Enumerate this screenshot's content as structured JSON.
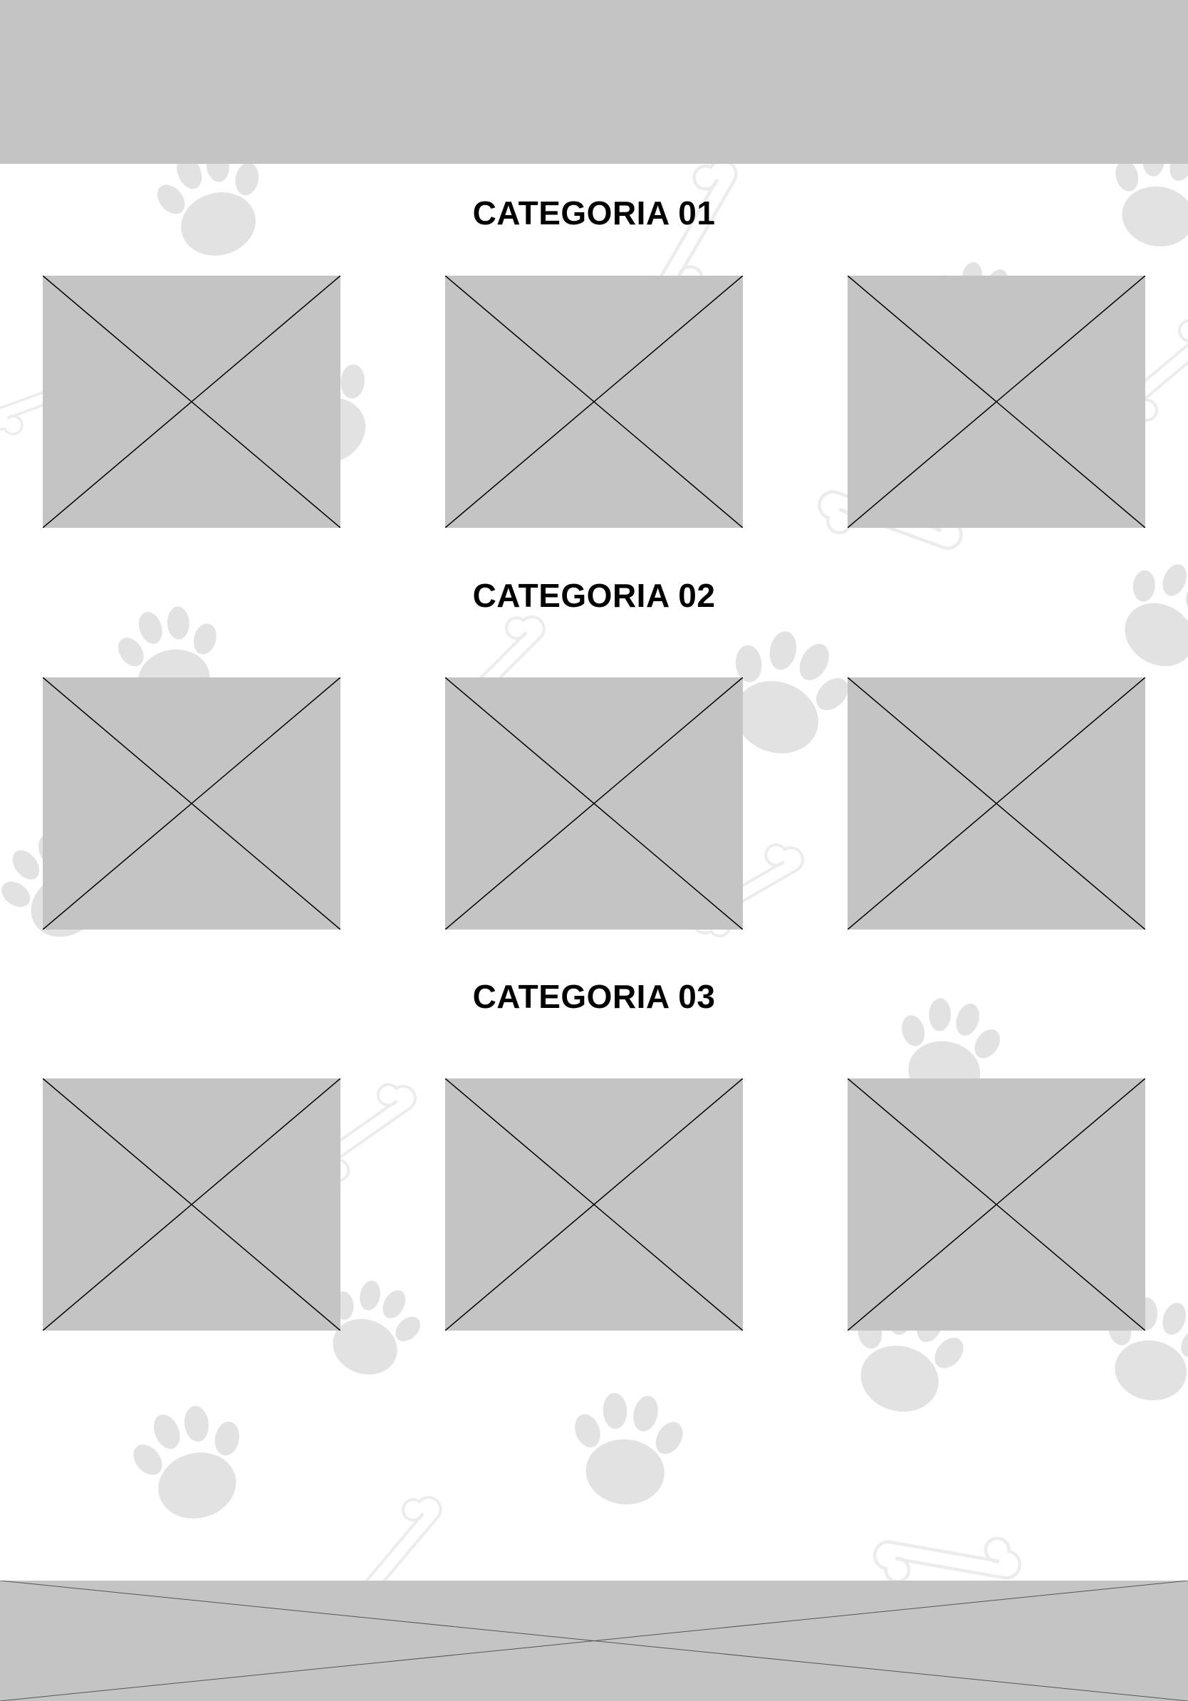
{
  "colors": {
    "placeholder_fill": "#c4c4c4",
    "placeholder_stroke": "#000000",
    "background": "#ffffff",
    "paw_print": "#e2e2e3",
    "bone_outline": "#ececec"
  },
  "header": {
    "icon": "banner-placeholder"
  },
  "categories": [
    {
      "title": "CATEGORIA 01",
      "items": [
        "image-placeholder",
        "image-placeholder",
        "image-placeholder"
      ]
    },
    {
      "title": "CATEGORIA 02",
      "items": [
        "image-placeholder",
        "image-placeholder",
        "image-placeholder"
      ]
    },
    {
      "title": "CATEGORIA 03",
      "items": [
        "image-placeholder",
        "image-placeholder",
        "image-placeholder"
      ]
    }
  ],
  "footer": {
    "icon": "image-placeholder"
  },
  "background": {
    "icons": [
      "paw-print-icon",
      "bone-icon"
    ]
  }
}
